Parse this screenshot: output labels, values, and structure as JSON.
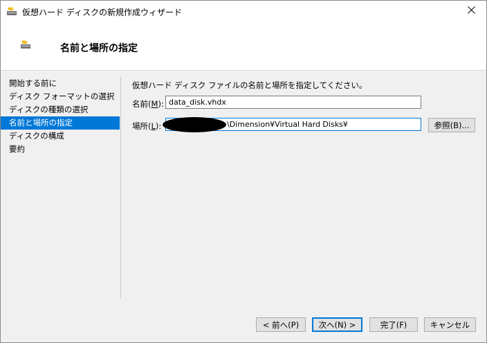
{
  "window": {
    "title": "仮想ハード ディスクの新規作成ウィザード"
  },
  "header": {
    "title": "名前と場所の指定"
  },
  "nav": {
    "items": [
      {
        "label": "開始する前に"
      },
      {
        "label": "ディスク フォーマットの選択"
      },
      {
        "label": "ディスクの種類の選択"
      },
      {
        "label": "名前と場所の指定"
      },
      {
        "label": "ディスクの構成"
      },
      {
        "label": "要約"
      }
    ],
    "selected_index": 3
  },
  "form": {
    "description": "仮想ハード ディスク ファイルの名前と場所を指定してください。",
    "name_label_prefix": "名前(",
    "name_label_key": "M",
    "name_label_suffix": "):",
    "name_value": "data_disk.vhdx",
    "location_label_prefix": "場所(",
    "location_label_key": "L",
    "location_label_suffix": "):",
    "location_value": "\\Dimension¥Virtual Hard Disks¥",
    "browse_label": "参照(B)..."
  },
  "footer": {
    "back_label": "< 前へ(P)",
    "next_label": "次へ(N) >",
    "finish_label": "完了(F)",
    "cancel_label": "キャンセル"
  },
  "colors": {
    "selection": "#0078d7",
    "background": "#f0f0f0"
  }
}
